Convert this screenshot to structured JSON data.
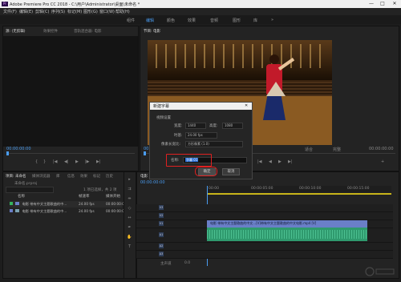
{
  "app": {
    "title": "Adobe Premiere Pro CC 2018 - C:\\用户\\Administrator\\桌面\\未命名 *",
    "icon_text": "Pr",
    "window_buttons": [
      "—",
      "□",
      "✕"
    ]
  },
  "menu": [
    "文件(F)",
    "编辑(E)",
    "剪辑(C)",
    "序列(S)",
    "标记(M)",
    "图形(G)",
    "窗口(W)",
    "帮助(H)"
  ],
  "workspaces": {
    "items": [
      "组件",
      "编辑",
      "颜色",
      "效果",
      "音频",
      "图形",
      "库"
    ],
    "active": "编辑",
    "more": "»"
  },
  "source_panel": {
    "tabs": [
      "源: (无剪辑)",
      "效果控件",
      "音轨混合器: 电影"
    ],
    "timecode": "00:00:00:00",
    "controls": [
      "{",
      "}",
      "|◀",
      "◀|",
      "▶",
      "|▶",
      "▶|"
    ]
  },
  "program_panel": {
    "tab": "节目: 电影",
    "timecode": "00:00:00:00",
    "fit": "适合",
    "quality": "完整",
    "end_timecode": "00:00:00:00",
    "controls": [
      "{",
      "}",
      "|◀",
      "◀",
      "▶",
      "▶|",
      "+"
    ]
  },
  "dialog": {
    "title": "新建字幕",
    "close": "✕",
    "section": "视频设置",
    "width_label": "宽度:",
    "width_value": "1440",
    "height_label": "高度:",
    "height_value": "1080",
    "timebase_label": "时基:",
    "timebase_value": "24.00 fps",
    "par_label": "像素长宽比:",
    "par_value": "方形像素 (1.0)",
    "name_label": "名称:",
    "name_value": "字幕 01",
    "ok": "确定",
    "cancel": "取消"
  },
  "project_panel": {
    "tabs": [
      "项目: 未命名",
      "媒体浏览器",
      "库",
      "信息",
      "效果",
      "标记",
      "历史"
    ],
    "project_file": "未命名.prproj",
    "item_count": "1 项已选择，共 2 项",
    "columns": [
      "名称",
      "帧速率",
      "媒体开始"
    ],
    "rows": [
      {
        "name": "电影 带有中文主题歌曲的中...",
        "fps": "24.00 fps",
        "start": "00:00:00:00"
      },
      {
        "name": "电影 带有中文主题歌曲的中...",
        "fps": "24.00 fps",
        "start": "00:00:00:00"
      }
    ]
  },
  "timeline": {
    "tab": "电影",
    "timecode": "00:00:00:00",
    "ruler_marks": [
      "00:00",
      "00:00:05:00",
      "00:00:10:00",
      "00:00:15:00"
    ],
    "tracks": [
      "V3",
      "V2",
      "V1",
      "A1",
      "A2",
      "A3"
    ],
    "video_clip": "电影 带有中文主题歌曲的中文...[V]带有中文主题歌曲的中文电影.mp4 [V]",
    "master": "主声道",
    "master_value": "0.0"
  },
  "colors": {
    "accent": "#4a9cf0",
    "highlight": "#e02020",
    "video_clip": "#6a7fc8",
    "audio_clip": "#2f9a6e"
  }
}
